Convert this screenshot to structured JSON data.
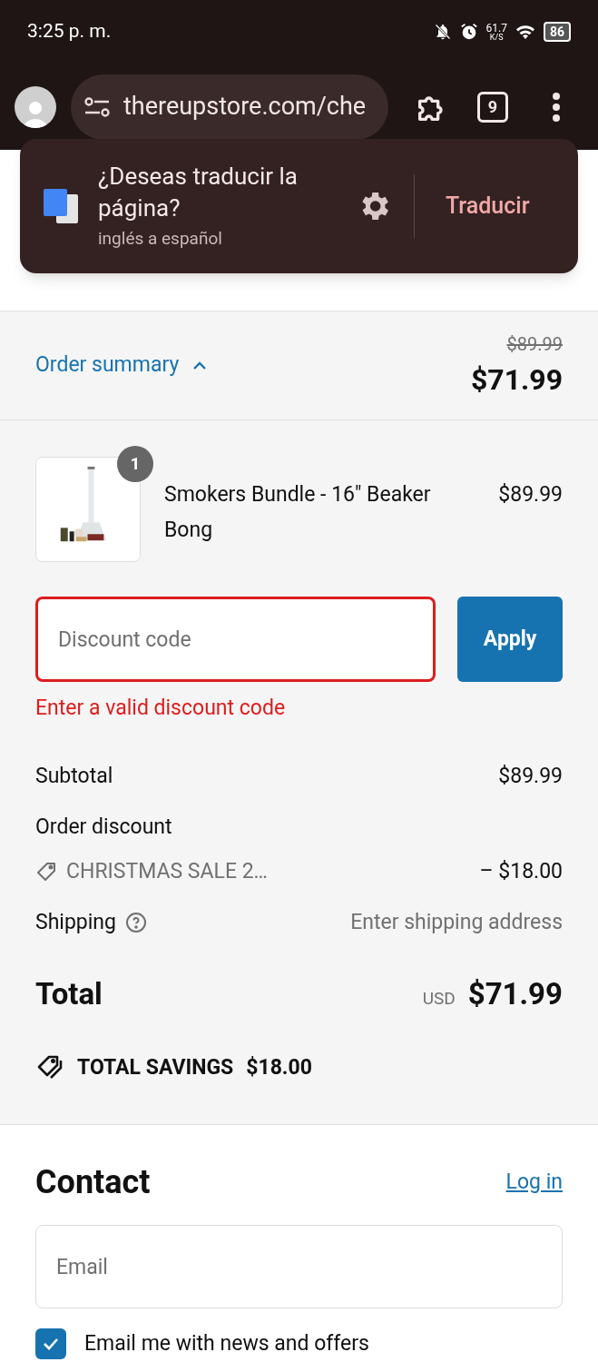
{
  "status_bar": {
    "time": "3:25 p. m.",
    "speed_value": "61.7",
    "speed_unit": "K/S",
    "battery": "86"
  },
  "browser": {
    "url": "thereupstore.com/che",
    "tab_count": "9"
  },
  "translate_prompt": {
    "title": "¿Deseas traducir la página?",
    "subtitle": "inglés a español",
    "action": "Traducir"
  },
  "order_summary": {
    "label": "Order summary",
    "expanded": true,
    "original_price": "$89.99",
    "price": "$71.99"
  },
  "items": [
    {
      "quantity": "1",
      "name": "Smokers Bundle - 16\" Beaker Bong",
      "price": "$89.99"
    }
  ],
  "discount": {
    "placeholder": "Discount code",
    "button": "Apply",
    "invalid": true,
    "error": "Enter a valid discount code"
  },
  "lines": [
    {
      "kind": "plain",
      "label": "Subtotal",
      "value": "$89.99"
    },
    {
      "kind": "discount",
      "label": "Order discount",
      "code": "CHRISTMAS SALE 2…",
      "value": "– $18.00"
    },
    {
      "kind": "help",
      "label": "Shipping",
      "value": "Enter shipping address"
    }
  ],
  "total": {
    "label": "Total",
    "currency": "USD",
    "value": "$71.99"
  },
  "savings": {
    "label": "TOTAL SAVINGS",
    "value": "$18.00"
  },
  "contact": {
    "title": "Contact",
    "login": "Log in",
    "email_placeholder": "Email",
    "newsletter": {
      "label": "Email me with news and offers",
      "checked": true
    }
  }
}
